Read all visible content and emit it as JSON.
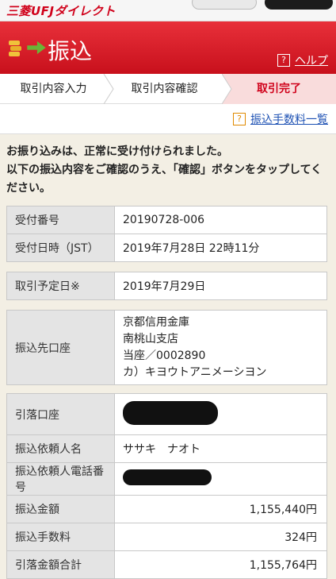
{
  "brand": "三菱UFJダイレクト",
  "header": {
    "title": "振込",
    "help_label": "ヘルプ",
    "help_icon": "?"
  },
  "steps": [
    "取引内容入力",
    "取引内容確認",
    "取引完了"
  ],
  "fee_link": {
    "icon": "?",
    "label": "振込手数料一覧"
  },
  "message": "お振り込みは、正常に受け付けられました。\n以下の振込内容をご確認のうえ、「確認」ボタンをタップしてください。",
  "receipt": {
    "number_label": "受付番号",
    "number": "20190728-006",
    "datetime_label": "受付日時（JST）",
    "datetime": "2019年7月28日 22時11分"
  },
  "schedule": {
    "label": "取引予定日※",
    "value": "2019年7月29日"
  },
  "payee": {
    "label": "振込先口座",
    "bank": "京都信用金庫",
    "branch": "南桃山支店",
    "account": "当座／0002890",
    "name": "カ）キヨウトアニメーシヨン"
  },
  "details": {
    "debit_label": "引落口座",
    "sender_label": "振込依頼人名",
    "sender": "ササキ　ナオト",
    "phone_label": "振込依頼人電話番号",
    "amount_label": "振込金額",
    "amount": "1,155,440円",
    "fee_label": "振込手数料",
    "fee": "324円",
    "total_label": "引落金額合計",
    "total": "1,155,764円"
  },
  "colors": {
    "brand_red": "#d0021b",
    "active_step_bg": "#f9dcdc",
    "link_blue": "#1c50b3"
  }
}
